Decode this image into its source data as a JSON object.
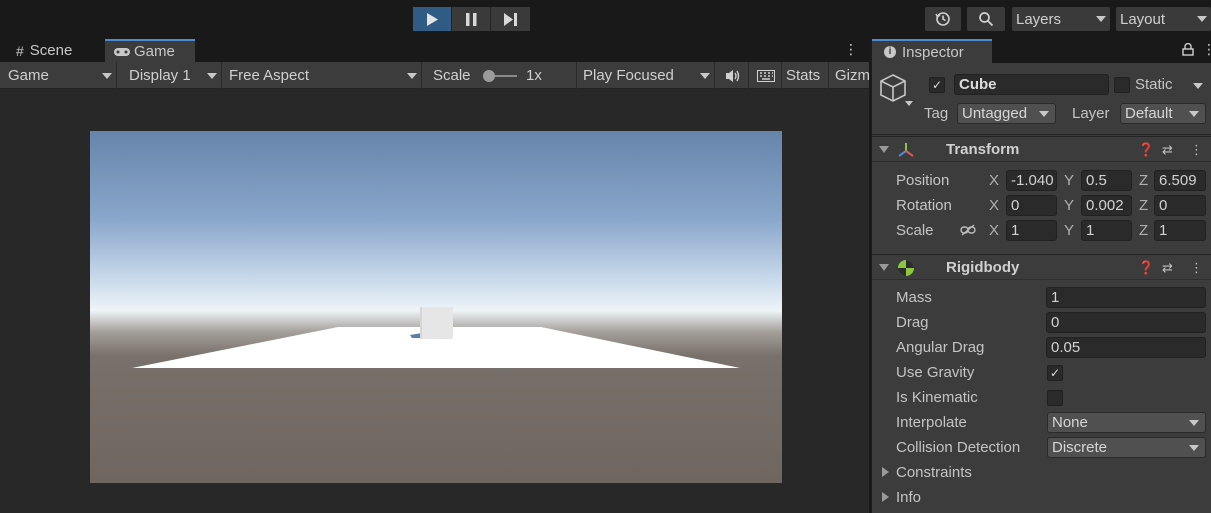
{
  "toolbar": {
    "layers_label": "Layers",
    "layout_label": "Layout"
  },
  "tabs": {
    "scene_label": "Scene",
    "game_label": "Game"
  },
  "game_toolbar": {
    "mode_label": "Game",
    "display_label": "Display 1",
    "aspect_label": "Free Aspect",
    "scale_label": "Scale",
    "scale_value": "1x",
    "play_mode_label": "Play Focused",
    "stats_label": "Stats",
    "gizmos_label": "Gizm"
  },
  "inspector": {
    "tab_label": "Inspector",
    "object_name": "Cube",
    "static_label": "Static",
    "tag_label": "Tag",
    "tag_value": "Untagged",
    "layer_label": "Layer",
    "layer_value": "Default",
    "active": true,
    "is_static": false
  },
  "transform": {
    "title": "Transform",
    "position_label": "Position",
    "rotation_label": "Rotation",
    "scale_label": "Scale",
    "axis_x": "X",
    "axis_y": "Y",
    "axis_z": "Z",
    "position": {
      "x": "-1.040",
      "y": "0.5",
      "z": "6.509"
    },
    "rotation": {
      "x": "0",
      "y": "0.002",
      "z": "0"
    },
    "scale": {
      "x": "1",
      "y": "1",
      "z": "1"
    }
  },
  "rigidbody": {
    "title": "Rigidbody",
    "mass_label": "Mass",
    "mass": "1",
    "drag_label": "Drag",
    "drag": "0",
    "angular_drag_label": "Angular Drag",
    "angular_drag": "0.05",
    "use_gravity_label": "Use Gravity",
    "use_gravity": true,
    "is_kinematic_label": "Is Kinematic",
    "is_kinematic": false,
    "interpolate_label": "Interpolate",
    "interpolate": "None",
    "collision_label": "Collision Detection",
    "collision": "Discrete",
    "constraints_label": "Constraints",
    "info_label": "Info"
  },
  "colors": {
    "accent": "#4b8bd4",
    "play_active": "#2f5b85",
    "panel_bg": "#3c3c3c",
    "rigidbody_icon": "#8dc63f"
  }
}
